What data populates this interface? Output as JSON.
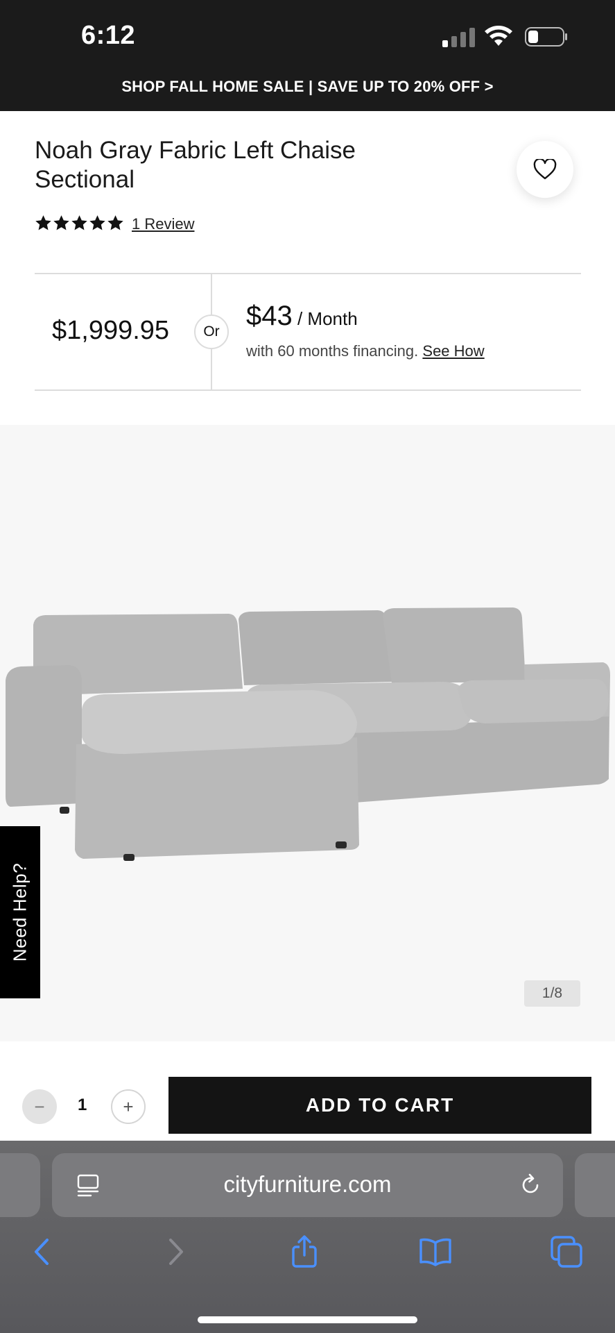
{
  "status_bar": {
    "time": "6:12"
  },
  "promo_banner": "SHOP FALL HOME SALE | SAVE UP TO 20% OFF >",
  "product": {
    "title": "Noah Gray Fabric Left Chaise Sectional",
    "rating_stars": 5,
    "review_link": "1 Review"
  },
  "pricing": {
    "price": "$1,999.95",
    "or_label": "Or",
    "monthly_amount": "$43",
    "monthly_unit": " / Month",
    "financing_text": "with 60 months financing.",
    "see_how": "See How"
  },
  "gallery": {
    "counter": "1/8",
    "help_tab": "Need Help?"
  },
  "cart": {
    "minus": "−",
    "quantity": "1",
    "plus": "+",
    "add_to_cart": "ADD TO CART"
  },
  "browser": {
    "url": "cityfurniture.com"
  },
  "colors": {
    "accent_blue": "#2f80ff",
    "dark": "#141414",
    "browser_bar": "#6a6a6c"
  }
}
